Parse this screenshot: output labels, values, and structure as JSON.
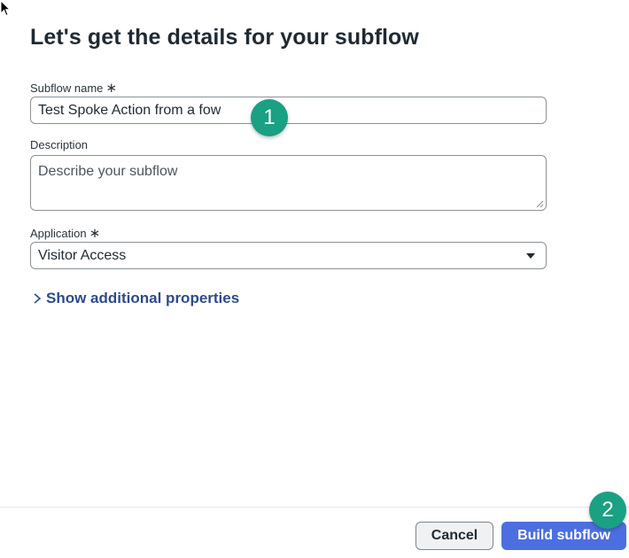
{
  "dialog": {
    "title": "Let's get the details for your subflow"
  },
  "form": {
    "subflow_name": {
      "label": "Subflow name",
      "required_mark": "∗",
      "value": "Test Spoke Action from a fow"
    },
    "description": {
      "label": "Description",
      "placeholder": "Describe your subflow"
    },
    "application": {
      "label": "Application",
      "required_mark": "∗",
      "selected": "Visitor Access"
    },
    "show_more_label": "Show additional properties"
  },
  "footer": {
    "cancel_label": "Cancel",
    "build_label": "Build subflow"
  },
  "annotations": {
    "step1": "1",
    "step2": "2",
    "color": "#1aa083"
  },
  "colors": {
    "primary_button": "#4d6ee0",
    "link": "#2f4a8a"
  },
  "icons": {
    "cursor": "mouse-pointer-icon",
    "chevron": "chevron-right-icon",
    "dropdown": "caret-down-icon"
  }
}
